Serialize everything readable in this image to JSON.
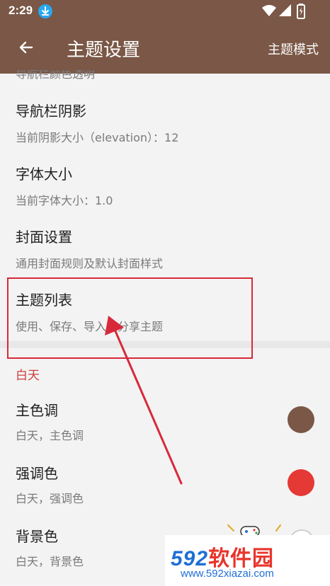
{
  "status_bar": {
    "time": "2:29",
    "icons": [
      "download-icon",
      "wifi-icon",
      "signal-icon",
      "battery-icon"
    ]
  },
  "app_bar": {
    "back_icon": "arrow-left-icon",
    "title": "主题设置",
    "action": "主题模式"
  },
  "settings": {
    "cut_item_sub": "导航栏颜色透明",
    "items": [
      {
        "title": "导航栏阴影",
        "subtitle": "当前阴影大小（elevation）：12"
      },
      {
        "title": "字体大小",
        "subtitle": "当前字体大小：1.0"
      },
      {
        "title": "封面设置",
        "subtitle": "通用封面规则及默认封面样式"
      },
      {
        "title": "主题列表",
        "subtitle": "使用、保存、导入或分享主题"
      }
    ]
  },
  "day_section": {
    "header": "白天",
    "items": [
      {
        "title": "主色调",
        "subtitle": "白天，主色调",
        "color": "#7a5746"
      },
      {
        "title": "强调色",
        "subtitle": "白天，强调色",
        "color": "#e53935"
      },
      {
        "title": "背景色",
        "subtitle": "白天，背景色",
        "color": "#ffffff"
      }
    ]
  },
  "annotation": {
    "color": "#d8293a"
  },
  "watermark": {
    "logo_digits": "592",
    "logo_text": "软件园",
    "url": "www.592xiazai.com"
  }
}
